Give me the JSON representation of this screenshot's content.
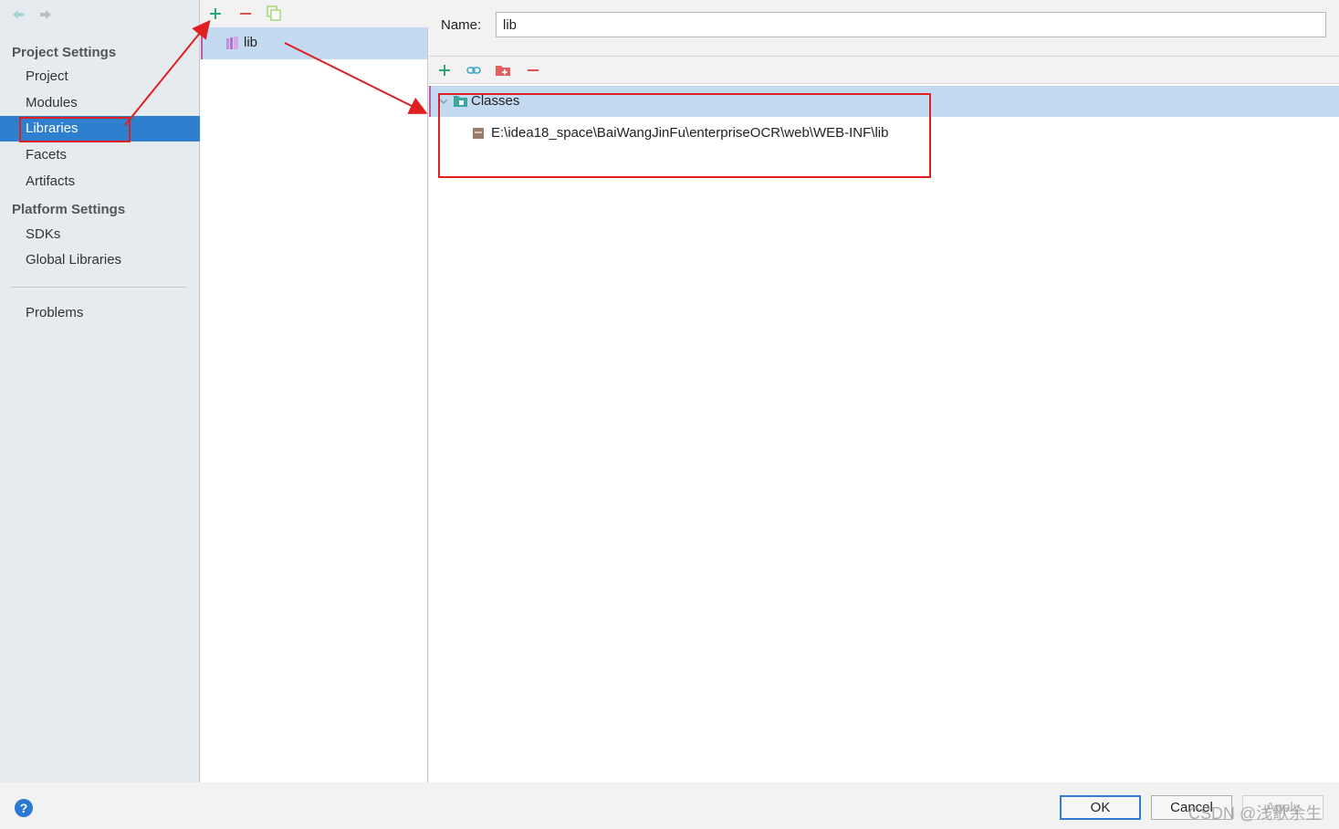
{
  "sidebar": {
    "section_project": "Project Settings",
    "items_project": [
      {
        "label": "Project"
      },
      {
        "label": "Modules"
      },
      {
        "label": "Libraries"
      },
      {
        "label": "Facets"
      },
      {
        "label": "Artifacts"
      }
    ],
    "section_platform": "Platform Settings",
    "items_platform": [
      {
        "label": "SDKs"
      },
      {
        "label": "Global Libraries"
      }
    ],
    "problems": "Problems",
    "selected": "Libraries"
  },
  "library_list": {
    "items": [
      {
        "label": "lib",
        "icon": "library-icon"
      }
    ]
  },
  "details": {
    "name_label": "Name:",
    "name_value": "lib",
    "tree": {
      "root_label": "Classes",
      "children": [
        {
          "label": "E:\\idea18_space\\BaiWangJinFu\\enterpriseOCR\\web\\WEB-INF\\lib",
          "icon": "jar-icon"
        }
      ]
    }
  },
  "footer": {
    "help": "?",
    "ok": "OK",
    "cancel": "Cancel",
    "apply": "Apply"
  },
  "watermark": "CSDN @浅歌余生",
  "colors": {
    "selection_blue": "#2f7fcf",
    "row_highlight": "#c4daf0",
    "annotation_red": "#e02020",
    "add_green": "#2aa876",
    "remove_red": "#e05050"
  }
}
